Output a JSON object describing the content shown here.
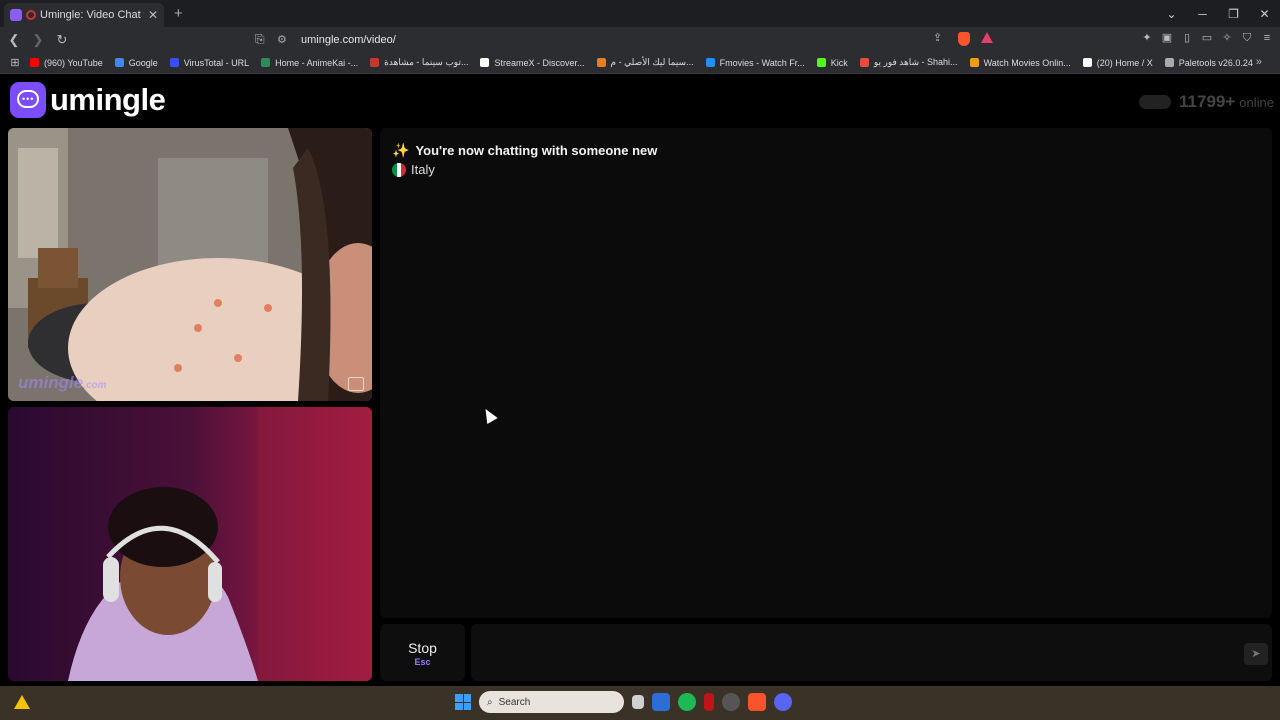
{
  "browser": {
    "tab_title": "Umingle: Video Chat with Str",
    "url": "umingle.com/video/",
    "new_tab_label": "+",
    "bookmarks": [
      {
        "label": "(960) YouTube",
        "color": "#ff0000"
      },
      {
        "label": "Google",
        "color": "#4285f4"
      },
      {
        "label": "VirusTotal - URL",
        "color": "#394eff"
      },
      {
        "label": "Home - AnimeKai -...",
        "color": "#2e8b57"
      },
      {
        "label": "توب سينما - مشاهدة...",
        "color": "#c0392b"
      },
      {
        "label": "StreameX - Discover...",
        "color": "#ffffff"
      },
      {
        "label": "سيما ليك الأصلي - م...",
        "color": "#e67e22"
      },
      {
        "label": "Fmovies - Watch Fr...",
        "color": "#1e90ff"
      },
      {
        "label": "Kick",
        "color": "#53fc18"
      },
      {
        "label": "شاهد فور يو - Shahi...",
        "color": "#e74c3c"
      },
      {
        "label": "Watch Movies Onlin...",
        "color": "#f39c12"
      },
      {
        "label": "(20) Home / X",
        "color": "#ffffff"
      },
      {
        "label": "Paletools v26.0.24",
        "color": "#aaaaaa"
      }
    ]
  },
  "site": {
    "logo_text": "umingle",
    "online_count": "11799+",
    "online_label": "online",
    "watermark": "umingle",
    "watermark_suffix": ".com",
    "accent": "#7c4dff"
  },
  "chat": {
    "system_message": "You're now chatting with someone new",
    "country": "Italy",
    "stop_label": "Stop",
    "stop_shortcut": "Esc",
    "input_placeholder": ""
  },
  "taskbar": {
    "search_placeholder": "Search"
  }
}
